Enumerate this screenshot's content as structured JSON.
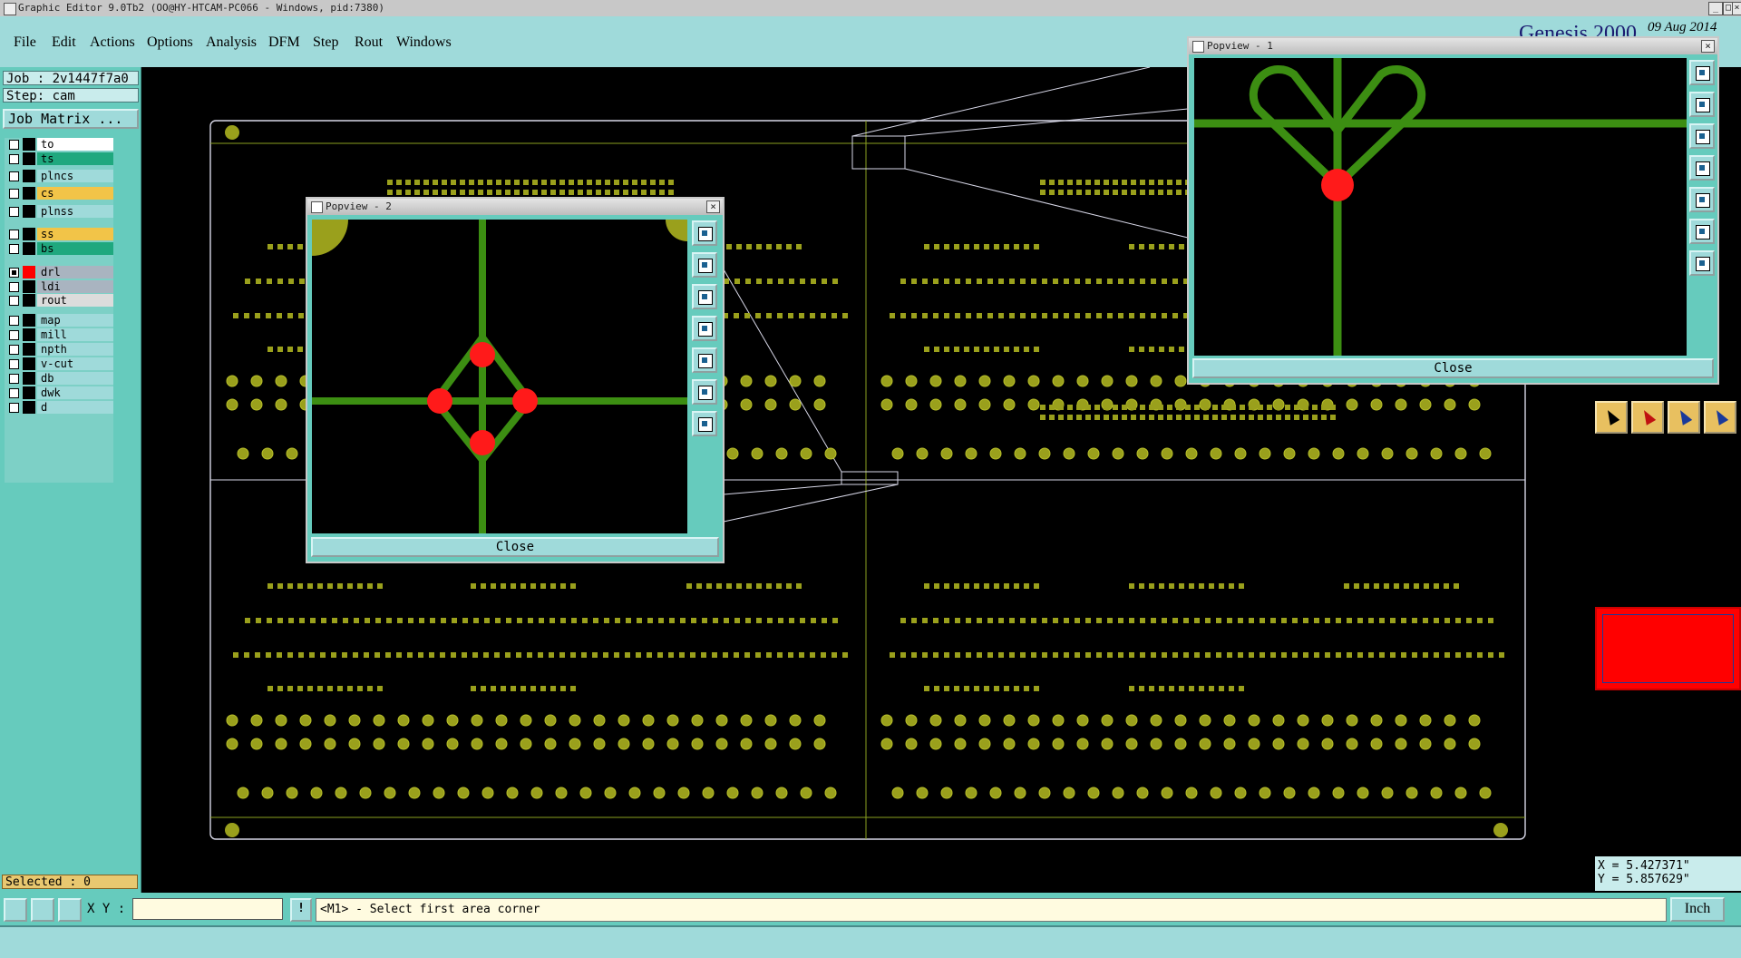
{
  "window": {
    "title": "Graphic Editor 9.0Tb2 (OO@HY-HTCAM-PC066 - Windows, pid:7380)",
    "minimize": "_",
    "maximize": "□",
    "close": "×"
  },
  "menu": {
    "items": [
      "File",
      "Edit",
      "Actions",
      "Options",
      "Analysis",
      "DFM",
      "Step",
      "Rout",
      "Windows"
    ]
  },
  "brand": {
    "name": "Genesis 2000",
    "date": "09 Aug 2014"
  },
  "job": {
    "job_label": "Job : 2v1447f7a0",
    "step_label": "Step: cam",
    "job_matrix_button": "Job Matrix ..."
  },
  "layers": [
    {
      "name": "to",
      "color": "#ffffff",
      "checked": false
    },
    {
      "name": "ts",
      "color": "#1fa87e",
      "checked": false
    },
    {
      "name": "plncs",
      "color": "#9fdada",
      "checked": false
    },
    {
      "name": "cs",
      "color": "#f2c448",
      "checked": false
    },
    {
      "name": "plnss",
      "color": "#9fdada",
      "checked": false
    },
    {
      "name": "ss",
      "color": "#f2c448",
      "checked": false
    },
    {
      "name": "bs",
      "color": "#1fa87e",
      "checked": false
    },
    {
      "name": "drl",
      "color": "#a9b4c0",
      "checked": true
    },
    {
      "name": "ldi",
      "color": "#a9b4c0",
      "checked": false
    },
    {
      "name": "rout",
      "color": "#dcdcdc",
      "checked": false
    },
    {
      "name": "map",
      "color": "#9fdada",
      "checked": false
    },
    {
      "name": "mill",
      "color": "#9fdada",
      "checked": false
    },
    {
      "name": "npth",
      "color": "#9fdada",
      "checked": false
    },
    {
      "name": "v-cut",
      "color": "#9fdada",
      "checked": false
    },
    {
      "name": "db",
      "color": "#9fdada",
      "checked": false
    },
    {
      "name": "dwk",
      "color": "#9fdada",
      "checked": false
    },
    {
      "name": "d",
      "color": "#9fdada",
      "checked": false
    }
  ],
  "selected": "Selected : 0",
  "popview1": {
    "title": "Popview - 1",
    "close_label": "Close",
    "close_icon": "×"
  },
  "popview2": {
    "title": "Popview - 2",
    "close_label": "Close",
    "close_icon": "×"
  },
  "coords": {
    "x": "X = 5.427371\"",
    "y": "Y = 5.857629\""
  },
  "cmd": {
    "xy_label": "X Y :",
    "xy_value": "",
    "bang": "!",
    "prompt": "<M1> - Select first area corner",
    "units": "Inch"
  },
  "colors": {
    "pad": "#9aa01c",
    "pad_edge": "#b9c02a",
    "trace": "#3c8e12",
    "drill": "#ff1a1a",
    "outline": "#d8d8e8",
    "teal": "#66cbbd"
  }
}
